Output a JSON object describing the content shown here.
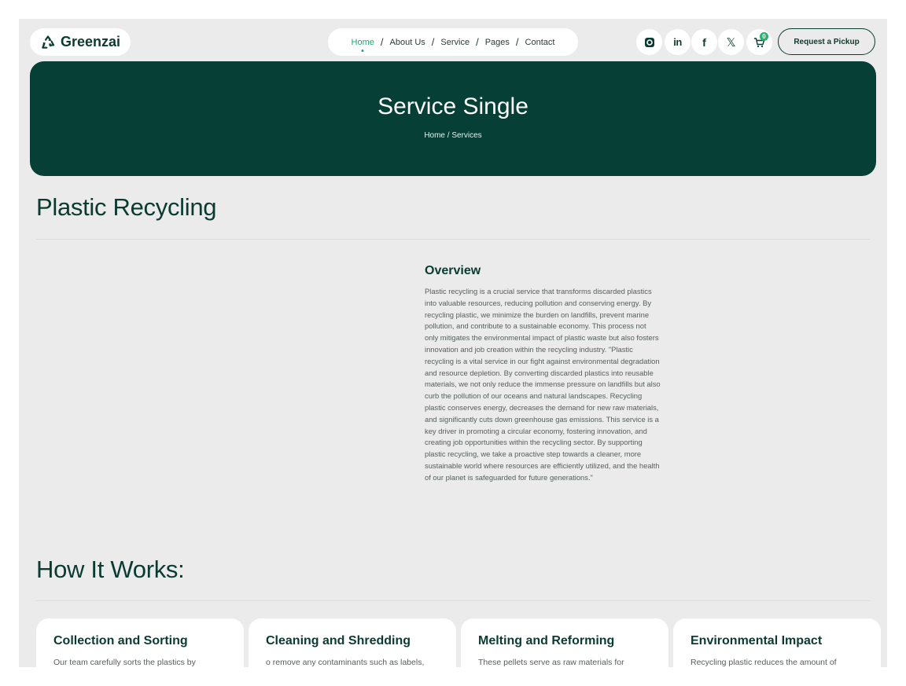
{
  "header": {
    "logo_text": "Greenzai",
    "nav": [
      "Home",
      "About Us",
      "Service",
      "Pages",
      "Contact"
    ],
    "social_icons": [
      "instagram-icon",
      "linkedin-icon",
      "facebook-icon",
      "x-icon",
      "cart-icon"
    ],
    "cart_count": "0",
    "cta_label": "Request a Pickup"
  },
  "hero": {
    "title": "Service Single",
    "breadcrumb": "Home / Services"
  },
  "main": {
    "service_title": "Plastic Recycling",
    "overview_heading": "Overview",
    "overview_text": "Plastic recycling is a crucial service that transforms discarded plastics into valuable resources, reducing pollution and conserving energy. By recycling plastic, we minimize the burden on landfills, prevent marine pollution, and contribute to a sustainable economy. This process not only mitigates the environmental impact of plastic waste but also fosters innovation and job creation within the recycling industry. \"Plastic recycling is a vital service in our fight against environmental degradation and resource depletion. By converting discarded plastics into reusable materials, we not only reduce the immense pressure on landfills but also curb the pollution of our oceans and natural landscapes. Recycling plastic conserves energy, decreases the demand for new raw materials, and significantly cuts down greenhouse gas emissions. This service is a key driver in promoting a circular economy, fostering innovation, and creating job opportunities within the recycling sector. By supporting plastic recycling, we take a proactive step towards a cleaner, more sustainable world where resources are efficiently utilized, and the health of our planet is safeguarded for future generations.\"",
    "how_title": "How It Works:",
    "cards": [
      {
        "title": "Collection and Sorting",
        "text": "Our team carefully sorts the plastics by"
      },
      {
        "title": "Cleaning and Shredding",
        "text": "o remove any contaminants such as labels,"
      },
      {
        "title": "Melting and Reforming",
        "text": "These pellets serve as raw materials for"
      },
      {
        "title": "Environmental Impact",
        "text": "Recycling plastic reduces the amount of"
      }
    ]
  },
  "colors": {
    "brand_dark": "#053f35",
    "accent_green": "#1faa6a",
    "page_bg": "#ebebeb"
  }
}
